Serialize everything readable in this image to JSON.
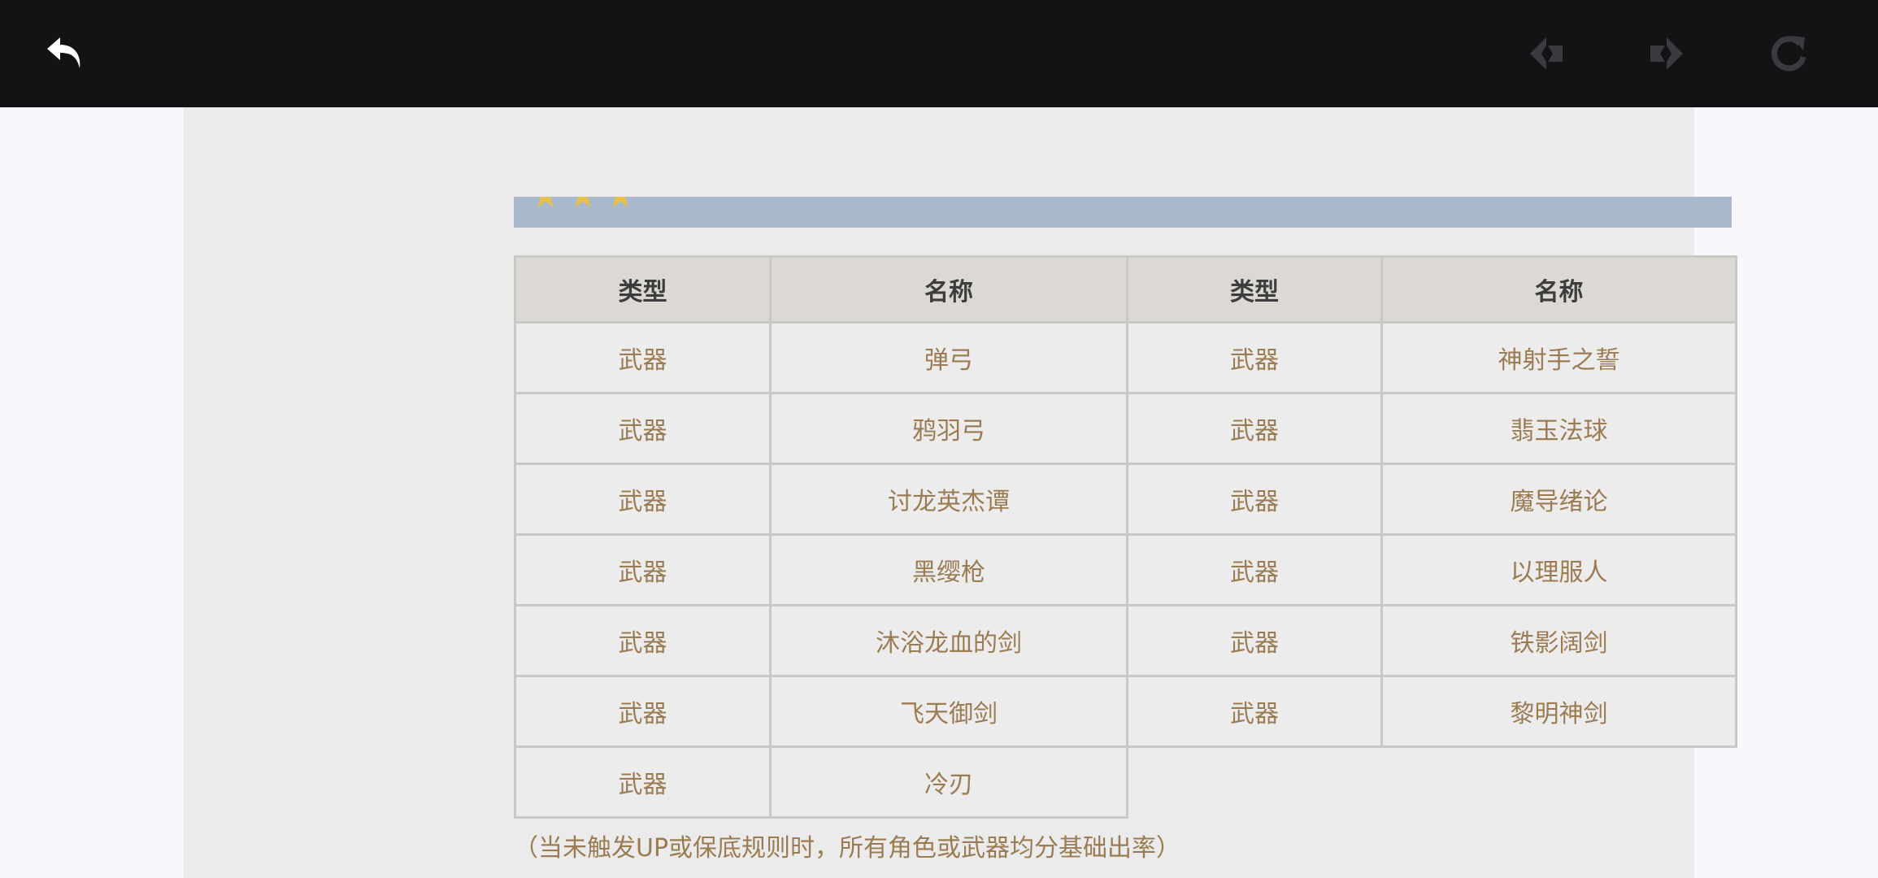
{
  "toolbar": {
    "back_icon": "back-arrow-icon",
    "prev_icon": "prev-arrow-icon",
    "next_icon": "next-arrow-icon",
    "reload_icon": "reload-icon"
  },
  "table": {
    "headers": [
      "类型",
      "名称",
      "类型",
      "名称"
    ],
    "rows": [
      [
        "武器",
        "弹弓",
        "武器",
        "神射手之誓"
      ],
      [
        "武器",
        "鸦羽弓",
        "武器",
        "翡玉法球"
      ],
      [
        "武器",
        "讨龙英杰谭",
        "武器",
        "魔导绪论"
      ],
      [
        "武器",
        "黑缨枪",
        "武器",
        "以理服人"
      ],
      [
        "武器",
        "沐浴龙血的剑",
        "武器",
        "铁影阔剑"
      ],
      [
        "武器",
        "飞天御剑",
        "武器",
        "黎明神剑"
      ],
      [
        "武器",
        "冷刃",
        "",
        ""
      ]
    ]
  },
  "note": "（当未触发UP或保底规则时，所有角色或武器均分基础出率）",
  "colors": {
    "topbar": "#121315",
    "banner": "#a9b8cb",
    "cell_text": "#9b7c52",
    "header_bg": "#dcd9d4"
  }
}
